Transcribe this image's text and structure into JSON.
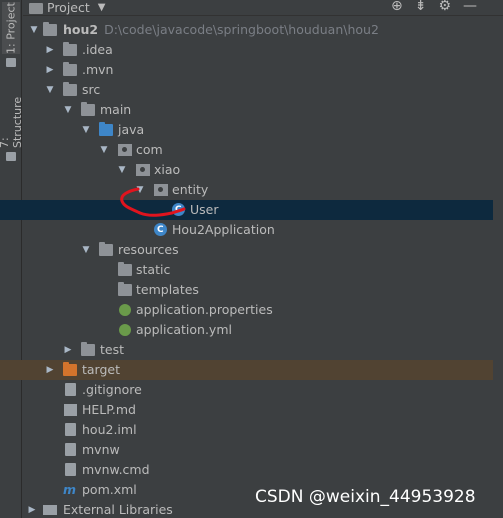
{
  "sidebar": {
    "project_tab": "1: Project",
    "structure_tab": "7: Structure"
  },
  "header": {
    "title": "Project",
    "dropdown_glyph": "▼",
    "tools": [
      "⊕",
      "⇟",
      "⚙",
      "—"
    ]
  },
  "tree": {
    "root_name": "hou2",
    "root_path": "D:\\code\\javacode\\springboot\\houduan\\hou2",
    "items": {
      "idea": ".idea",
      "mvn": ".mvn",
      "src": "src",
      "main": "main",
      "java": "java",
      "com": "com",
      "xiao": "xiao",
      "entity": "entity",
      "user": "User",
      "hou2app": "Hou2Application",
      "resources": "resources",
      "static": "static",
      "templates": "templates",
      "app_props": "application.properties",
      "app_yml": "application.yml",
      "test": "test",
      "target": "target",
      "gitignore": ".gitignore",
      "help": "HELP.md",
      "iml": "hou2.iml",
      "mvnw": "mvnw",
      "mvnw_cmd": "mvnw.cmd",
      "pom": "pom.xml",
      "ext_libs": "External Libraries"
    }
  },
  "watermark": "CSDN @weixin_44953928",
  "colors": {
    "background": "#3c3f41",
    "selection": "#0d293e",
    "target_highlight": "#514332",
    "annotation": "#e0141e"
  }
}
